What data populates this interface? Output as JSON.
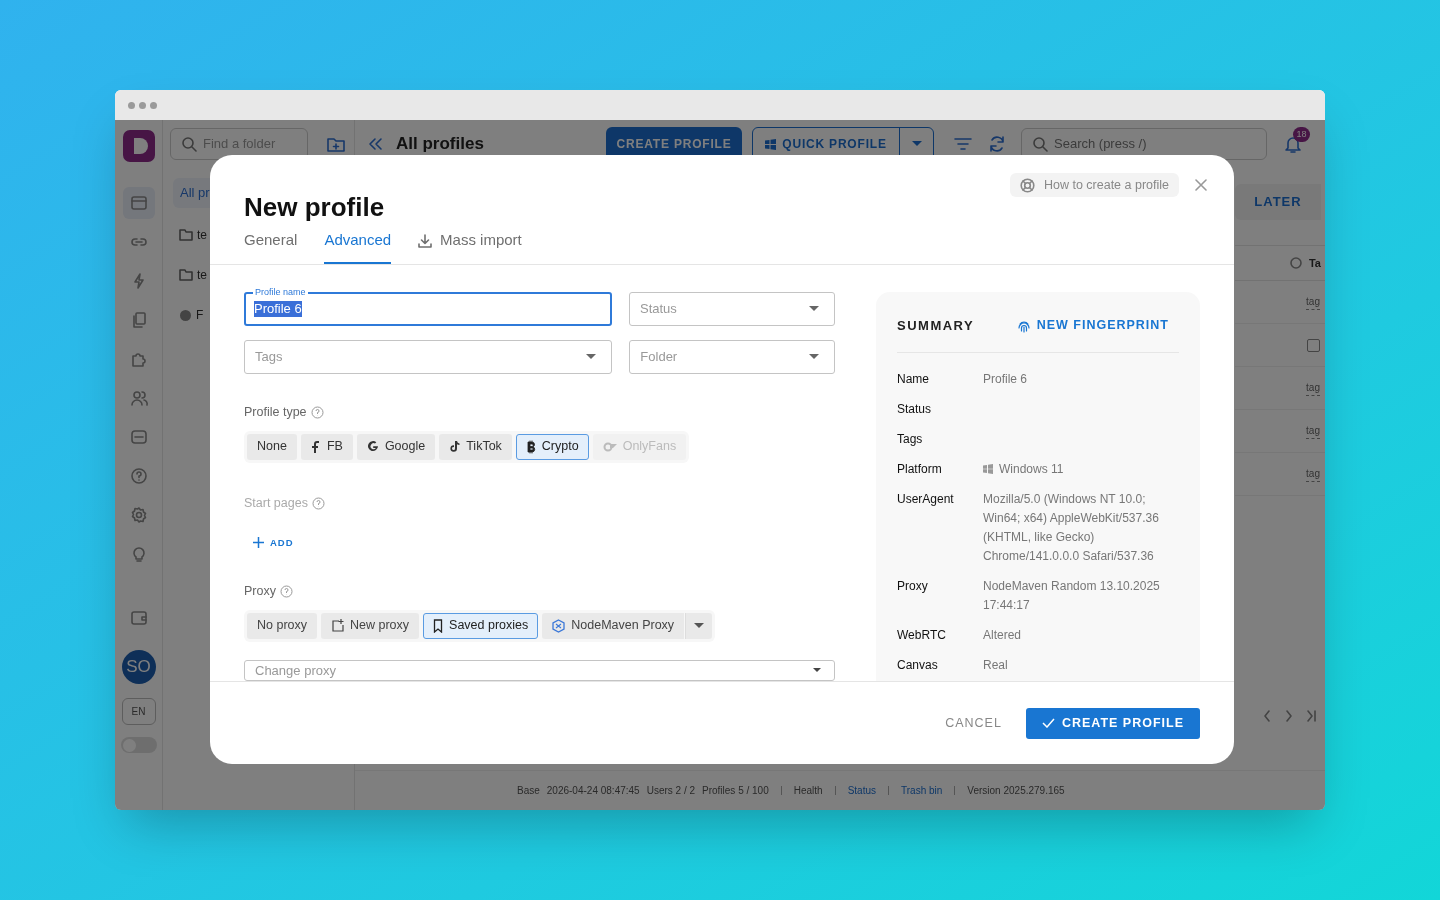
{
  "app": {
    "folder_search": {
      "placeholder": "Find a folder"
    },
    "all_folders": "All pr",
    "folders": [
      {
        "label": "te",
        "kind": "folder"
      },
      {
        "label": "te",
        "kind": "folder"
      },
      {
        "label": "F",
        "kind": "shared"
      }
    ],
    "title": "All profiles",
    "create_button": "CREATE PROFILE",
    "quick_button": "QUICK PROFILE",
    "search": {
      "placeholder": "Search (press /)"
    },
    "notifications": "18",
    "later_button": "LATER",
    "column_label": "Ta",
    "rows": [
      {
        "kind": "tag",
        "text": "tag"
      },
      {
        "kind": "checkbox",
        "checked": false
      },
      {
        "kind": "tag",
        "text": "tag"
      },
      {
        "kind": "tag",
        "text": "tag"
      },
      {
        "kind": "tag",
        "text": "tag"
      }
    ],
    "avatar": "SO",
    "language": "EN",
    "dark_mode": false,
    "status_bar": [
      {
        "kind": "text",
        "text": "Base"
      },
      {
        "kind": "text",
        "text": "2026-04-24 08:47:45"
      },
      {
        "kind": "text",
        "text": "Users 2 / 2"
      },
      {
        "kind": "text",
        "text": "Profiles 5 / 100"
      },
      {
        "kind": "separator"
      },
      {
        "kind": "text",
        "text": "Health"
      },
      {
        "kind": "separator"
      },
      {
        "kind": "link",
        "text": "Status"
      },
      {
        "kind": "separator"
      },
      {
        "kind": "link",
        "text": "Trash bin"
      },
      {
        "kind": "separator"
      },
      {
        "kind": "text",
        "text": "Version 2025.279.165"
      }
    ]
  },
  "modal": {
    "title": "New profile",
    "help_button": "How to create a profile",
    "tabs": [
      {
        "label": "General",
        "selected": false,
        "kind": "plain"
      },
      {
        "label": "Advanced",
        "selected": true,
        "kind": "plain"
      },
      {
        "label": "Mass import",
        "selected": false,
        "kind": "download"
      }
    ],
    "profile_name": {
      "label": "Profile name",
      "value": "Profile 6"
    },
    "status": {
      "placeholder": "Status"
    },
    "tags": {
      "placeholder": "Tags"
    },
    "folder": {
      "placeholder": "Folder"
    },
    "profile_type": {
      "label": "Profile type",
      "options": [
        {
          "label": "None",
          "kind": "none",
          "selected": false,
          "disabled": false
        },
        {
          "label": "FB",
          "kind": "facebook",
          "selected": false,
          "disabled": false
        },
        {
          "label": "Google",
          "kind": "google",
          "selected": false,
          "disabled": false
        },
        {
          "label": "TikTok",
          "kind": "tiktok",
          "selected": false,
          "disabled": false
        },
        {
          "label": "Crypto",
          "kind": "crypto",
          "selected": true,
          "disabled": false
        },
        {
          "label": "OnlyFans",
          "kind": "onlyfans",
          "selected": false,
          "disabled": true
        }
      ]
    },
    "start_pages": {
      "label": "Start pages",
      "add_button": "ADD"
    },
    "proxy": {
      "label": "Proxy",
      "options": [
        {
          "label": "No proxy",
          "kind": "none",
          "selected": false
        },
        {
          "label": "New proxy",
          "kind": "new",
          "selected": false
        },
        {
          "label": "Saved proxies",
          "kind": "saved",
          "selected": true
        },
        {
          "label": "NodeMaven Proxy",
          "kind": "nodemaven",
          "selected": false
        }
      ],
      "change_proxy": {
        "placeholder": "Change proxy"
      }
    },
    "summary": {
      "title": "SUMMARY",
      "fingerprint_button": "NEW FINGERPRINT",
      "rows": [
        {
          "label": "Name",
          "value": "Profile 6",
          "kind": "text"
        },
        {
          "label": "Status",
          "kind": "text"
        },
        {
          "label": "Tags",
          "kind": "text"
        },
        {
          "label": "Platform",
          "value": "Windows 11",
          "kind": "windows"
        },
        {
          "label": "UserAgent",
          "value": "Mozilla/5.0 (Windows NT 10.0; Win64; x64) AppleWebKit/537.36 (KHTML, like Gecko) Chrome/141.0.0.0 Safari/537.36",
          "kind": "text"
        },
        {
          "label": "Proxy",
          "value": "NodeMaven Random 13.10.2025 17:44:17",
          "kind": "text"
        },
        {
          "label": "WebRTC",
          "value": "Altered",
          "kind": "text"
        },
        {
          "label": "Canvas",
          "value": "Real",
          "kind": "text"
        }
      ]
    },
    "cancel_button": "CANCEL",
    "create_button": "CREATE PROFILE"
  }
}
